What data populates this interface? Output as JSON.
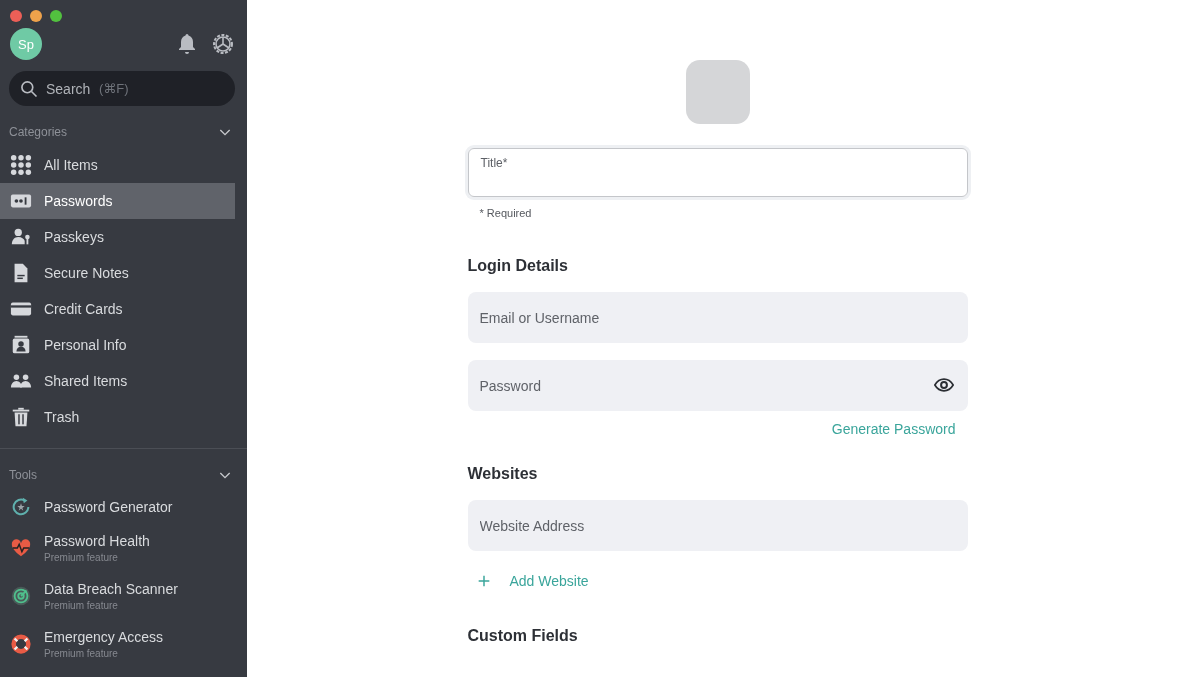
{
  "sidebar": {
    "avatar": "Sp",
    "search": {
      "placeholder": "Search",
      "shortcut": "(⌘F)"
    },
    "categories": {
      "label": "Categories",
      "expanded": true,
      "items": [
        {
          "label": "All Items",
          "selected": false
        },
        {
          "label": "Passwords",
          "selected": true
        },
        {
          "label": "Passkeys",
          "selected": false
        },
        {
          "label": "Secure Notes",
          "selected": false
        },
        {
          "label": "Credit Cards",
          "selected": false
        },
        {
          "label": "Personal Info",
          "selected": false
        },
        {
          "label": "Shared Items",
          "selected": false
        },
        {
          "label": "Trash",
          "selected": false
        }
      ]
    },
    "tools": {
      "label": "Tools",
      "expanded": true,
      "items": [
        {
          "label": "Password Generator"
        },
        {
          "label": "Password Health",
          "note": "Premium feature"
        },
        {
          "label": "Data Breach Scanner",
          "note": "Premium feature"
        },
        {
          "label": "Emergency Access",
          "note": "Premium feature"
        }
      ]
    }
  },
  "form": {
    "title_field": {
      "label": "Title*"
    },
    "required_note": "* Required",
    "sections": [
      {
        "heading": "Login Details",
        "fields": [
          {
            "placeholder": "Email or Username",
            "kind": "text"
          },
          {
            "placeholder": "Password",
            "kind": "password"
          }
        ],
        "link": "Generate Password"
      },
      {
        "heading": "Websites",
        "fields": [
          {
            "placeholder": "Website Address",
            "kind": "text"
          }
        ],
        "add": "Add Website"
      },
      {
        "heading": "Custom Fields"
      }
    ]
  }
}
